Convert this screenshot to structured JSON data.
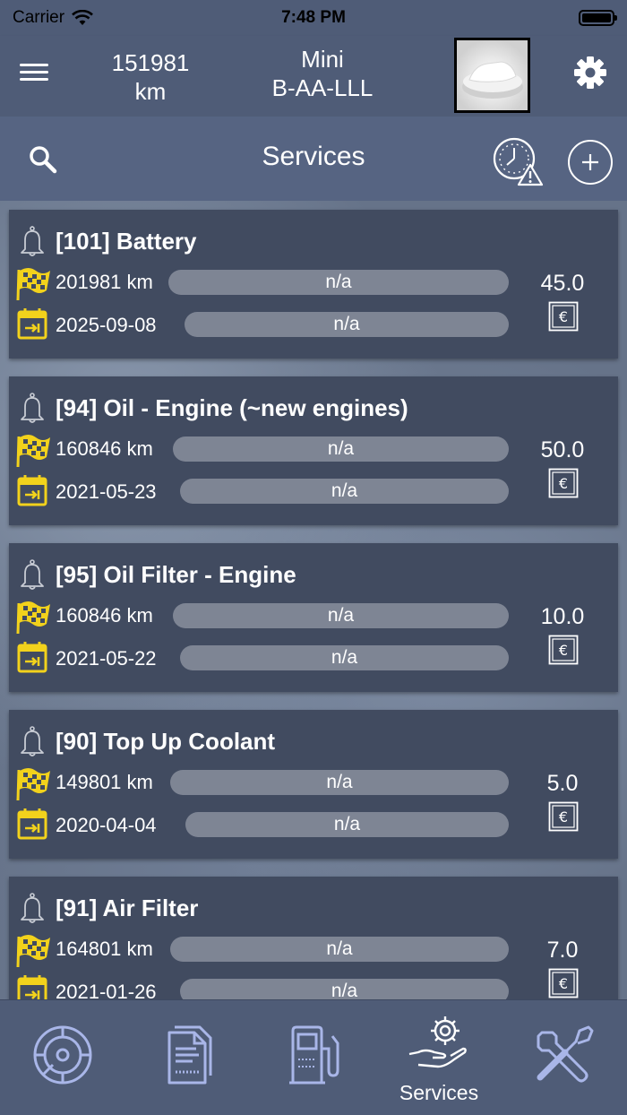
{
  "status_bar": {
    "carrier": "Carrier",
    "time": "7:48 PM"
  },
  "header": {
    "odometer_value": "151981",
    "odometer_unit": "km",
    "vehicle_name": "Mini",
    "vehicle_plate": "B-AA-LLL"
  },
  "subheader": {
    "title": "Services"
  },
  "services": [
    {
      "title": "[101] Battery",
      "km": "201981 km",
      "km_status": "n/a",
      "date": "2025-09-08",
      "date_status": "n/a",
      "cost": "45.0"
    },
    {
      "title": "[94] Oil - Engine (~new engines)",
      "km": "160846 km",
      "km_status": "n/a",
      "date": "2021-05-23",
      "date_status": "n/a",
      "cost": "50.0"
    },
    {
      "title": "[95] Oil Filter - Engine",
      "km": "160846 km",
      "km_status": "n/a",
      "date": "2021-05-22",
      "date_status": "n/a",
      "cost": "10.0"
    },
    {
      "title": "[90] Top Up Coolant",
      "km": "149801 km",
      "km_status": "n/a",
      "date": "2020-04-04",
      "date_status": "n/a",
      "cost": "5.0"
    },
    {
      "title": "[91] Air Filter",
      "km": "164801 km",
      "km_status": "n/a",
      "date": "2021-01-26",
      "date_status": "n/a",
      "cost": "7.0"
    }
  ],
  "tabs": [
    {
      "icon": "dashboard-gauge-icon",
      "label": ""
    },
    {
      "icon": "documents-icon",
      "label": ""
    },
    {
      "icon": "fuel-pump-icon",
      "label": ""
    },
    {
      "icon": "services-gear-hand-icon",
      "label": "Services",
      "selected": true
    },
    {
      "icon": "tools-icon",
      "label": ""
    }
  ],
  "colors": {
    "header_bg": "#4f5c77",
    "card_bg": "#414b60",
    "bar_bg": "#7e8594",
    "accent_yellow": "#f2d21c",
    "tab_icon": "#a9b6e8"
  }
}
